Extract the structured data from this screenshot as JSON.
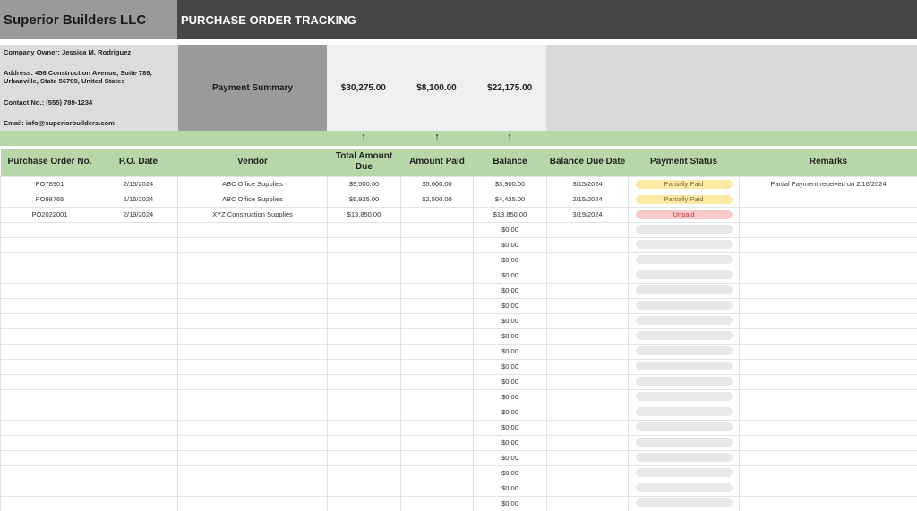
{
  "header": {
    "company_name": "Superior Builders LLC",
    "title": "PURCHASE ORDER TRACKING"
  },
  "company_info": {
    "owner": "Company Owner: Jessica M. Rodriguez",
    "address_line1": "Address: 456 Construction Avenue, Suite 789,",
    "address_line2": "Urbanville, State 56789, United States",
    "contact": "Contact No.: (555) 789-1234",
    "email": "Email: info@superiorbuilders.com"
  },
  "payment_summary": {
    "label": "Payment Summary",
    "total_amount_due": "$30,275.00",
    "amount_paid": "$8,100.00",
    "balance": "$22,175.00",
    "arrow_icon": "↑"
  },
  "table": {
    "columns": [
      "Purchase Order No.",
      "P.O. Date",
      "Vendor",
      "Total Amount Due",
      "Amount Paid",
      "Balance",
      "Balance Due Date",
      "Payment Status",
      "Remarks"
    ],
    "rows": [
      {
        "po": "PO78901",
        "date": "2/15/2024",
        "vendor": "ABC Office Supplies",
        "total": "$9,500.00",
        "paid": "$5,600.00",
        "balance": "$3,900.00",
        "due": "3/15/2024",
        "status": "Partially Paid",
        "status_type": "partial",
        "remarks": "Partial Payment received on 2/16/2024"
      },
      {
        "po": "PO98765",
        "date": "1/15/2024",
        "vendor": "ABC Office Supplies",
        "total": "$6,925.00",
        "paid": "$2,500.00",
        "balance": "$4,425.00",
        "due": "2/15/2024",
        "status": "Partially Paid",
        "status_type": "partial",
        "remarks": ""
      },
      {
        "po": "PO2022001",
        "date": "2/19/2024",
        "vendor": "XYZ Construction Supplies",
        "total": "$13,850.00",
        "paid": "",
        "balance": "$13,850.00",
        "due": "3/19/2024",
        "status": "Unpaid",
        "status_type": "unpaid",
        "remarks": ""
      },
      {
        "po": "",
        "date": "",
        "vendor": "",
        "total": "",
        "paid": "",
        "balance": "$0.00",
        "due": "",
        "status": "",
        "status_type": "empty",
        "remarks": ""
      },
      {
        "po": "",
        "date": "",
        "vendor": "",
        "total": "",
        "paid": "",
        "balance": "$0.00",
        "due": "",
        "status": "",
        "status_type": "empty",
        "remarks": ""
      },
      {
        "po": "",
        "date": "",
        "vendor": "",
        "total": "",
        "paid": "",
        "balance": "$0.00",
        "due": "",
        "status": "",
        "status_type": "empty",
        "remarks": ""
      },
      {
        "po": "",
        "date": "",
        "vendor": "",
        "total": "",
        "paid": "",
        "balance": "$0.00",
        "due": "",
        "status": "",
        "status_type": "empty",
        "remarks": ""
      },
      {
        "po": "",
        "date": "",
        "vendor": "",
        "total": "",
        "paid": "",
        "balance": "$0.00",
        "due": "",
        "status": "",
        "status_type": "empty",
        "remarks": ""
      },
      {
        "po": "",
        "date": "",
        "vendor": "",
        "total": "",
        "paid": "",
        "balance": "$0.00",
        "due": "",
        "status": "",
        "status_type": "empty",
        "remarks": ""
      },
      {
        "po": "",
        "date": "",
        "vendor": "",
        "total": "",
        "paid": "",
        "balance": "$0.00",
        "due": "",
        "status": "",
        "status_type": "empty",
        "remarks": ""
      },
      {
        "po": "",
        "date": "",
        "vendor": "",
        "total": "",
        "paid": "",
        "balance": "$0.00",
        "due": "",
        "status": "",
        "status_type": "empty",
        "remarks": ""
      },
      {
        "po": "",
        "date": "",
        "vendor": "",
        "total": "",
        "paid": "",
        "balance": "$0.00",
        "due": "",
        "status": "",
        "status_type": "empty",
        "remarks": ""
      },
      {
        "po": "",
        "date": "",
        "vendor": "",
        "total": "",
        "paid": "",
        "balance": "$0.00",
        "due": "",
        "status": "",
        "status_type": "empty",
        "remarks": ""
      },
      {
        "po": "",
        "date": "",
        "vendor": "",
        "total": "",
        "paid": "",
        "balance": "$0.00",
        "due": "",
        "status": "",
        "status_type": "empty",
        "remarks": ""
      },
      {
        "po": "",
        "date": "",
        "vendor": "",
        "total": "",
        "paid": "",
        "balance": "$0.00",
        "due": "",
        "status": "",
        "status_type": "empty",
        "remarks": ""
      },
      {
        "po": "",
        "date": "",
        "vendor": "",
        "total": "",
        "paid": "",
        "balance": "$0.00",
        "due": "",
        "status": "",
        "status_type": "empty",
        "remarks": ""
      },
      {
        "po": "",
        "date": "",
        "vendor": "",
        "total": "",
        "paid": "",
        "balance": "$0.00",
        "due": "",
        "status": "",
        "status_type": "empty",
        "remarks": ""
      },
      {
        "po": "",
        "date": "",
        "vendor": "",
        "total": "",
        "paid": "",
        "balance": "$0.00",
        "due": "",
        "status": "",
        "status_type": "empty",
        "remarks": ""
      },
      {
        "po": "",
        "date": "",
        "vendor": "",
        "total": "",
        "paid": "",
        "balance": "$0.00",
        "due": "",
        "status": "",
        "status_type": "empty",
        "remarks": ""
      },
      {
        "po": "",
        "date": "",
        "vendor": "",
        "total": "",
        "paid": "",
        "balance": "$0.00",
        "due": "",
        "status": "",
        "status_type": "empty",
        "remarks": ""
      },
      {
        "po": "",
        "date": "",
        "vendor": "",
        "total": "",
        "paid": "",
        "balance": "$0.00",
        "due": "",
        "status": "",
        "status_type": "empty",
        "remarks": ""
      },
      {
        "po": "",
        "date": "",
        "vendor": "",
        "total": "",
        "paid": "",
        "balance": "$0.00",
        "due": "",
        "status": "",
        "status_type": "empty",
        "remarks": ""
      }
    ]
  }
}
